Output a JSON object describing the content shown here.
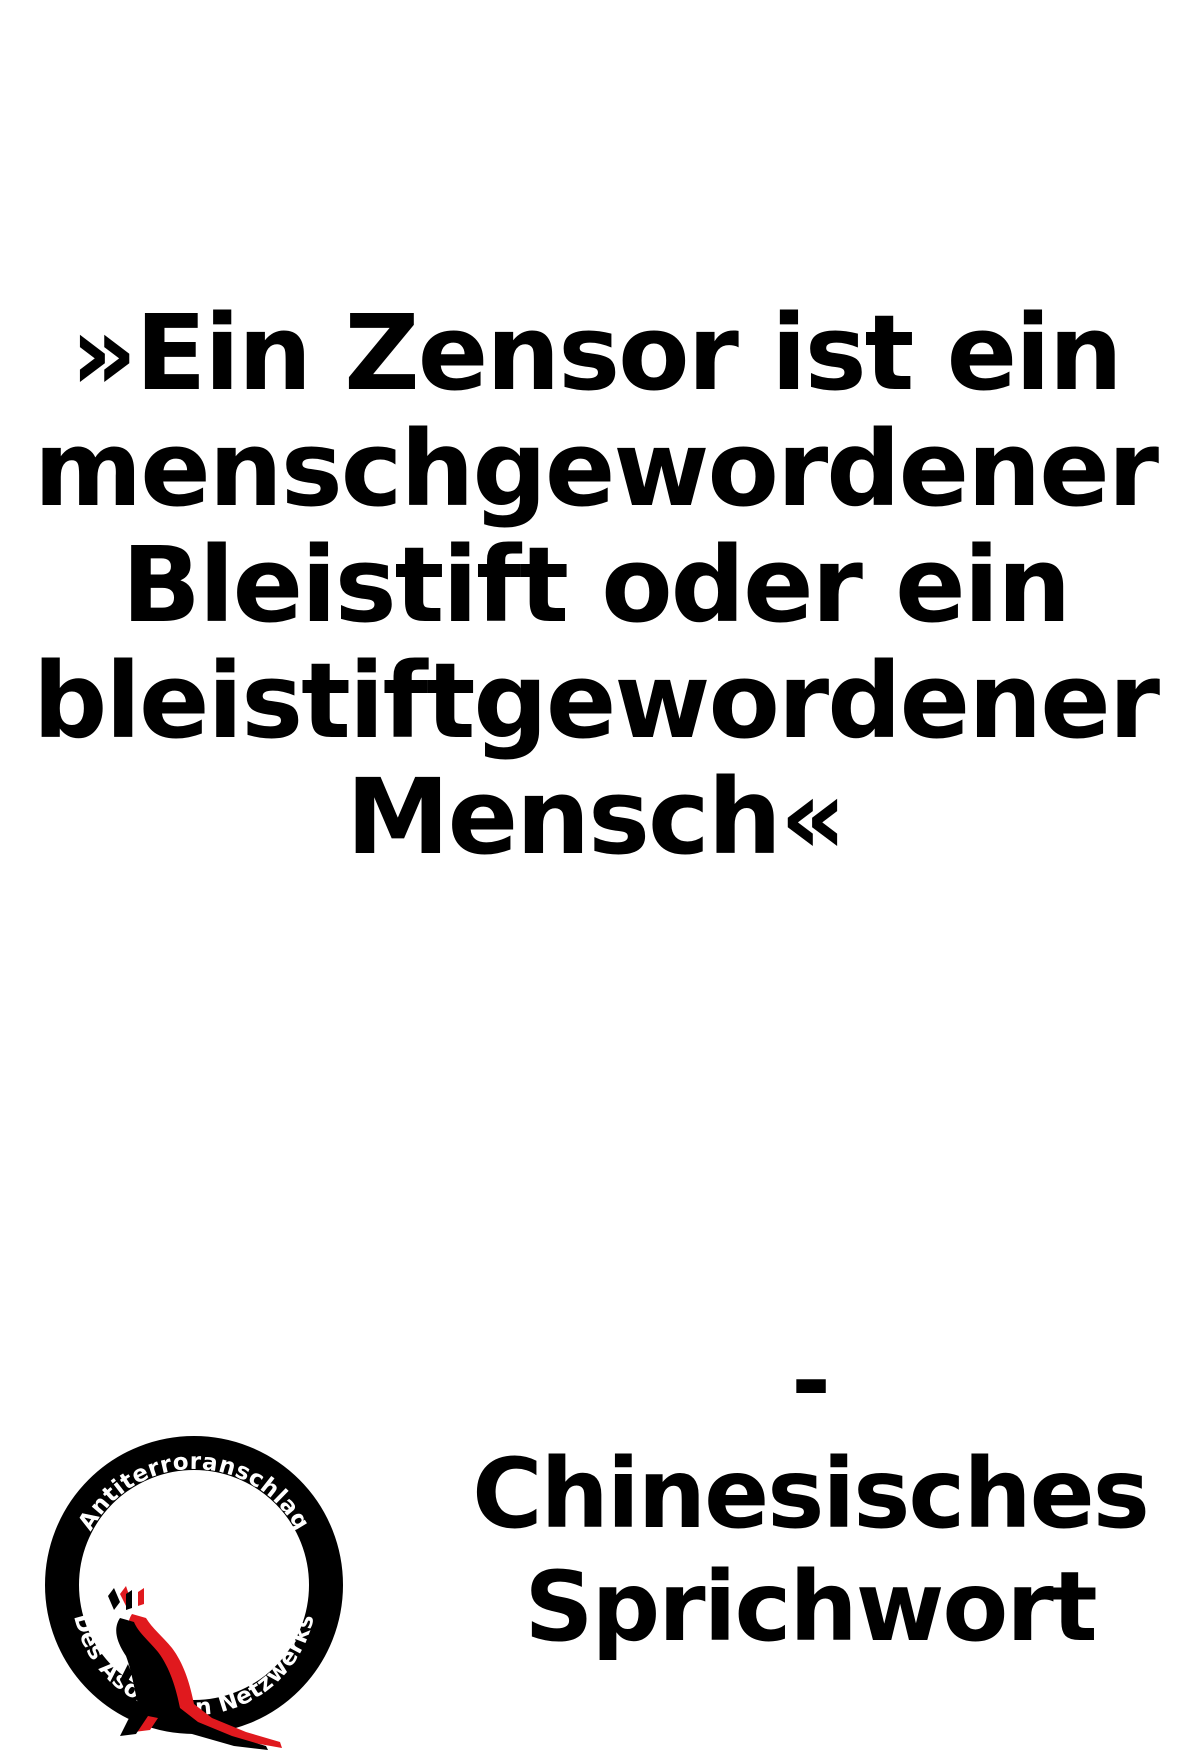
{
  "quote": {
    "lines": [
      "»Ein Zensor ist ein",
      "menschgewordener",
      "Bleistift oder ein",
      "bleistiftgewordener",
      "Mensch«"
    ]
  },
  "attribution": {
    "lines": [
      "-",
      "Chinesisches",
      "Sprichwort"
    ]
  },
  "logo": {
    "top_text": "Antiterroranschlag",
    "bottom_text": "Des Asozialen Netzwerks",
    "icon": "kangaroo-icon",
    "colors": {
      "ring": "#000000",
      "accent": "#e0191e",
      "text": "#ffffff"
    }
  }
}
